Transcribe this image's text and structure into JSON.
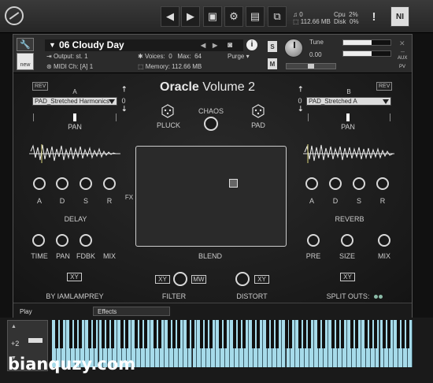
{
  "topbar": {
    "nav_prev": "◀",
    "nav_next": "▶",
    "memory_voices": "0",
    "memory_size": "112.66 MB",
    "cpu_label": "Cpu",
    "cpu_value": "2%",
    "disk_label": "Disk",
    "disk_value": "0%",
    "warning_icon": "!",
    "ni_logo": "NI"
  },
  "header": {
    "new_label": "new",
    "preset_name": "06 Cloudy Day",
    "output_label": "Output:",
    "output_value": "st. 1",
    "voices_label": "Voices:",
    "voices_value": "0",
    "max_label": "Max:",
    "max_value": "64",
    "purge_label": "Purge",
    "midi_label": "MIDI Ch:",
    "midi_value": "[A]  1",
    "memory_label": "Memory:",
    "memory_value": "112.66 MB",
    "solo": "S",
    "mute": "M",
    "tune_label": "Tune",
    "tune_value": "0.00",
    "aux_label": "AUX",
    "pv_label": "PV",
    "volume_level": 0.6
  },
  "instrument": {
    "title_bold": "Oracle",
    "title_rest": " Volume 2",
    "rev_a": "REV",
    "rev_b": "REV",
    "layer_a_label": "A",
    "layer_b_label": "B",
    "layer_a_sample": "PAD_Stretched Harmonics",
    "layer_b_sample": "PAD_Stretched A",
    "layer_a_value": "0",
    "layer_b_value": "0",
    "pan_label_a": "PAN",
    "pan_label_b": "PAN",
    "pluck_label": "PLUCK",
    "pad_label": "PAD",
    "chaos_label": "CHAOS",
    "fx_label": "FX",
    "adsr_a": [
      "A",
      "D",
      "S",
      "R"
    ],
    "adsr_b": [
      "A",
      "D",
      "S",
      "R"
    ],
    "delay_label": "DELAY",
    "reverb_label": "REVERB",
    "delay_knobs": [
      "TIME",
      "PAN",
      "FDBK",
      "MIX"
    ],
    "reverb_knobs": [
      "PRE",
      "SIZE",
      "MIX"
    ],
    "blend_label": "BLEND",
    "xy_left": "XY",
    "xy_right": "XY",
    "xy_filter": "XY",
    "mw_filter": "MW",
    "xy_distort": "XY",
    "credit": "BY IAMLAMPREY",
    "filter_label": "FILTER",
    "distort_label": "DISTORT",
    "split_outs_label": "SPLIT OUTS:"
  },
  "tabs": {
    "play": "Play",
    "effects": "Effects"
  },
  "keyboard": {
    "octave": "+2"
  },
  "watermark": "bianquzy.com"
}
